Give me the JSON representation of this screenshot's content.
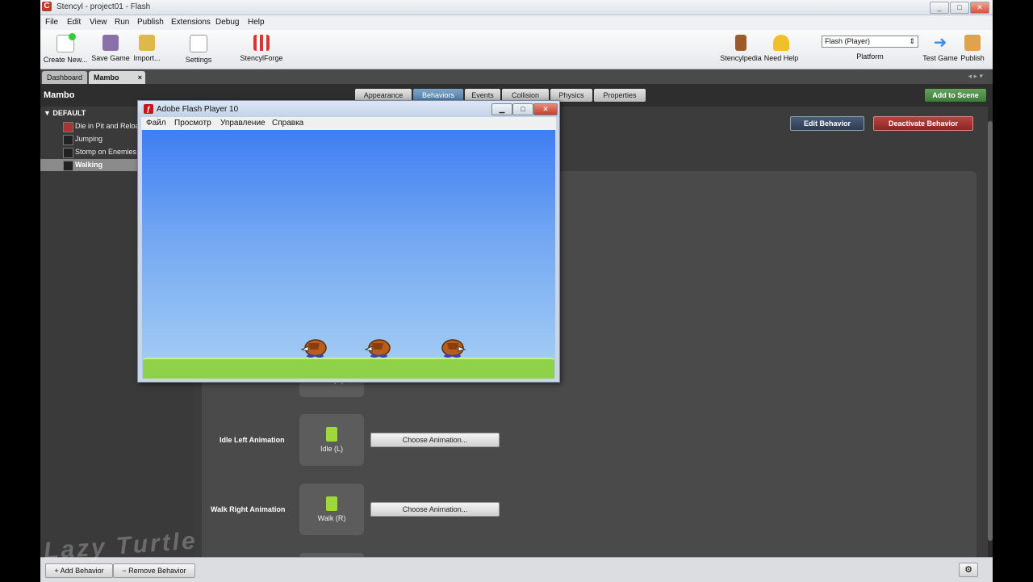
{
  "titlebar": {
    "title": "Stencyl - project01 - Flash",
    "app_icon": "C",
    "min": "_",
    "max": "□",
    "close": "✕"
  },
  "menu": [
    "File",
    "Edit",
    "View",
    "Run",
    "Publish",
    "Extensions",
    "Debug",
    "Help"
  ],
  "toolbar": {
    "left": [
      "Create New...",
      "Save Game",
      "Import...",
      "Settings",
      "StencylForge"
    ],
    "right": [
      "Stencylpedia",
      "Need Help",
      "Platform",
      "Test Game",
      "Publish"
    ],
    "platform_select": "Flash (Player)"
  },
  "tabs": {
    "dashboard": "Dashboard",
    "current": "Mambo",
    "close": "×"
  },
  "header": {
    "actor_name": "Mambo",
    "panel_tabs": [
      "Appearance",
      "Behaviors",
      "Events",
      "Collision",
      "Physics",
      "Properties"
    ],
    "add_to_scene": "Add to Scene"
  },
  "sidebar": {
    "group": "DEFAULT",
    "items": [
      {
        "label": "Die in Pit and Reload"
      },
      {
        "label": "Jumping"
      },
      {
        "label": "Stomp on Enemies"
      },
      {
        "label": "Walking",
        "selected": true
      }
    ]
  },
  "behavior_buttons": {
    "edit": "Edit Behavior",
    "deactivate": "Deactivate Behavior"
  },
  "animation_rows": [
    {
      "label": "",
      "anim": "Idle (R)",
      "button": ""
    },
    {
      "label": "Idle Left Animation",
      "anim": "Idle (L)",
      "button": "Choose Animation..."
    },
    {
      "label": "Walk Right Animation",
      "anim": "Walk (R)",
      "button": "Choose Animation..."
    }
  ],
  "bottombar": {
    "add": "Add Behavior",
    "remove": "Remove Behavior",
    "gear": "⚙"
  },
  "watermark": "Lazy Turtle",
  "flash_window": {
    "title": "Adobe Flash Player 10",
    "icon": "ƒ",
    "menu": [
      "Файл",
      "Просмотр",
      "Управление",
      "Справка"
    ]
  },
  "colors": {
    "accent_tab": "#4b7aa6",
    "add_scene": "#3e7b3b",
    "deactivate": "#8a2724",
    "sky_top": "#3f7ef2",
    "ground": "#8fd24a"
  }
}
